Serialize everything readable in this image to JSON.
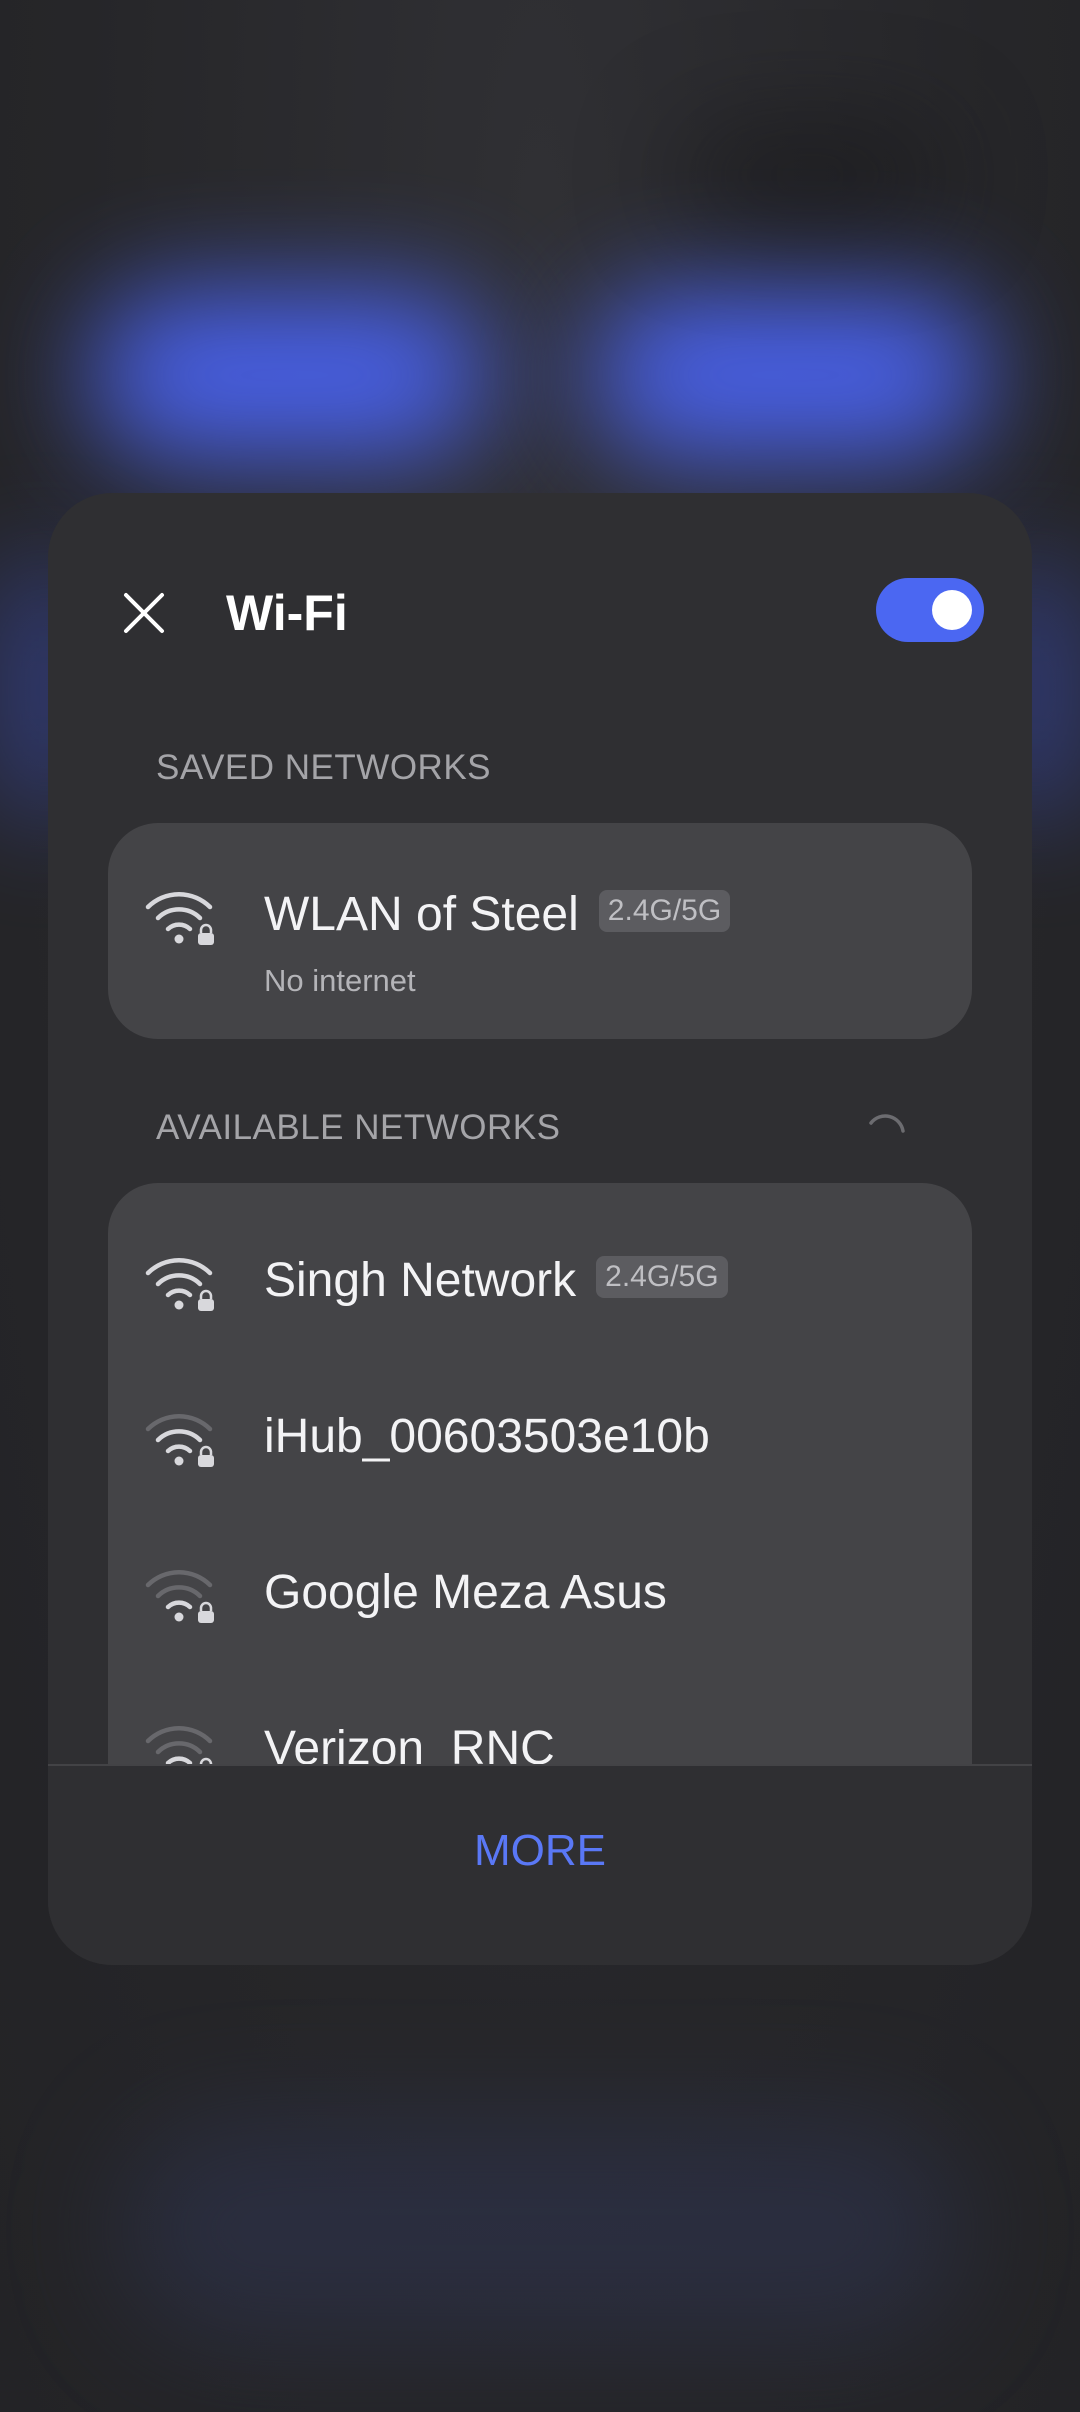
{
  "header": {
    "title": "Wi-Fi",
    "close_icon": "close-icon",
    "toggle_state": "on"
  },
  "saved_networks": {
    "label": "SAVED NETWORKS",
    "items": [
      {
        "name": "WLAN of Steel",
        "band": "2.4G/5G",
        "status": "No internet",
        "icon": "wifi-lock-icon",
        "signal": "full"
      }
    ]
  },
  "available_networks": {
    "label": "AVAILABLE NETWORKS",
    "spinner_icon": "loading-spinner-icon",
    "items": [
      {
        "name": "Singh Network",
        "band": "2.4G/5G",
        "icon": "wifi-lock-icon",
        "signal": "full"
      },
      {
        "name": "iHub_00603503e10b",
        "icon": "wifi-lock-icon",
        "signal": "medium"
      },
      {
        "name": "Google Meza Asus",
        "icon": "wifi-lock-icon",
        "signal": "low"
      },
      {
        "name": "Verizon_RNC",
        "icon": "wifi-lock-icon",
        "signal": "low"
      }
    ]
  },
  "footer": {
    "more_label": "MORE"
  },
  "colors": {
    "accent": "#4b67f2",
    "link": "#5a78f6",
    "panel": "#2f2f32",
    "card": "#444447"
  }
}
